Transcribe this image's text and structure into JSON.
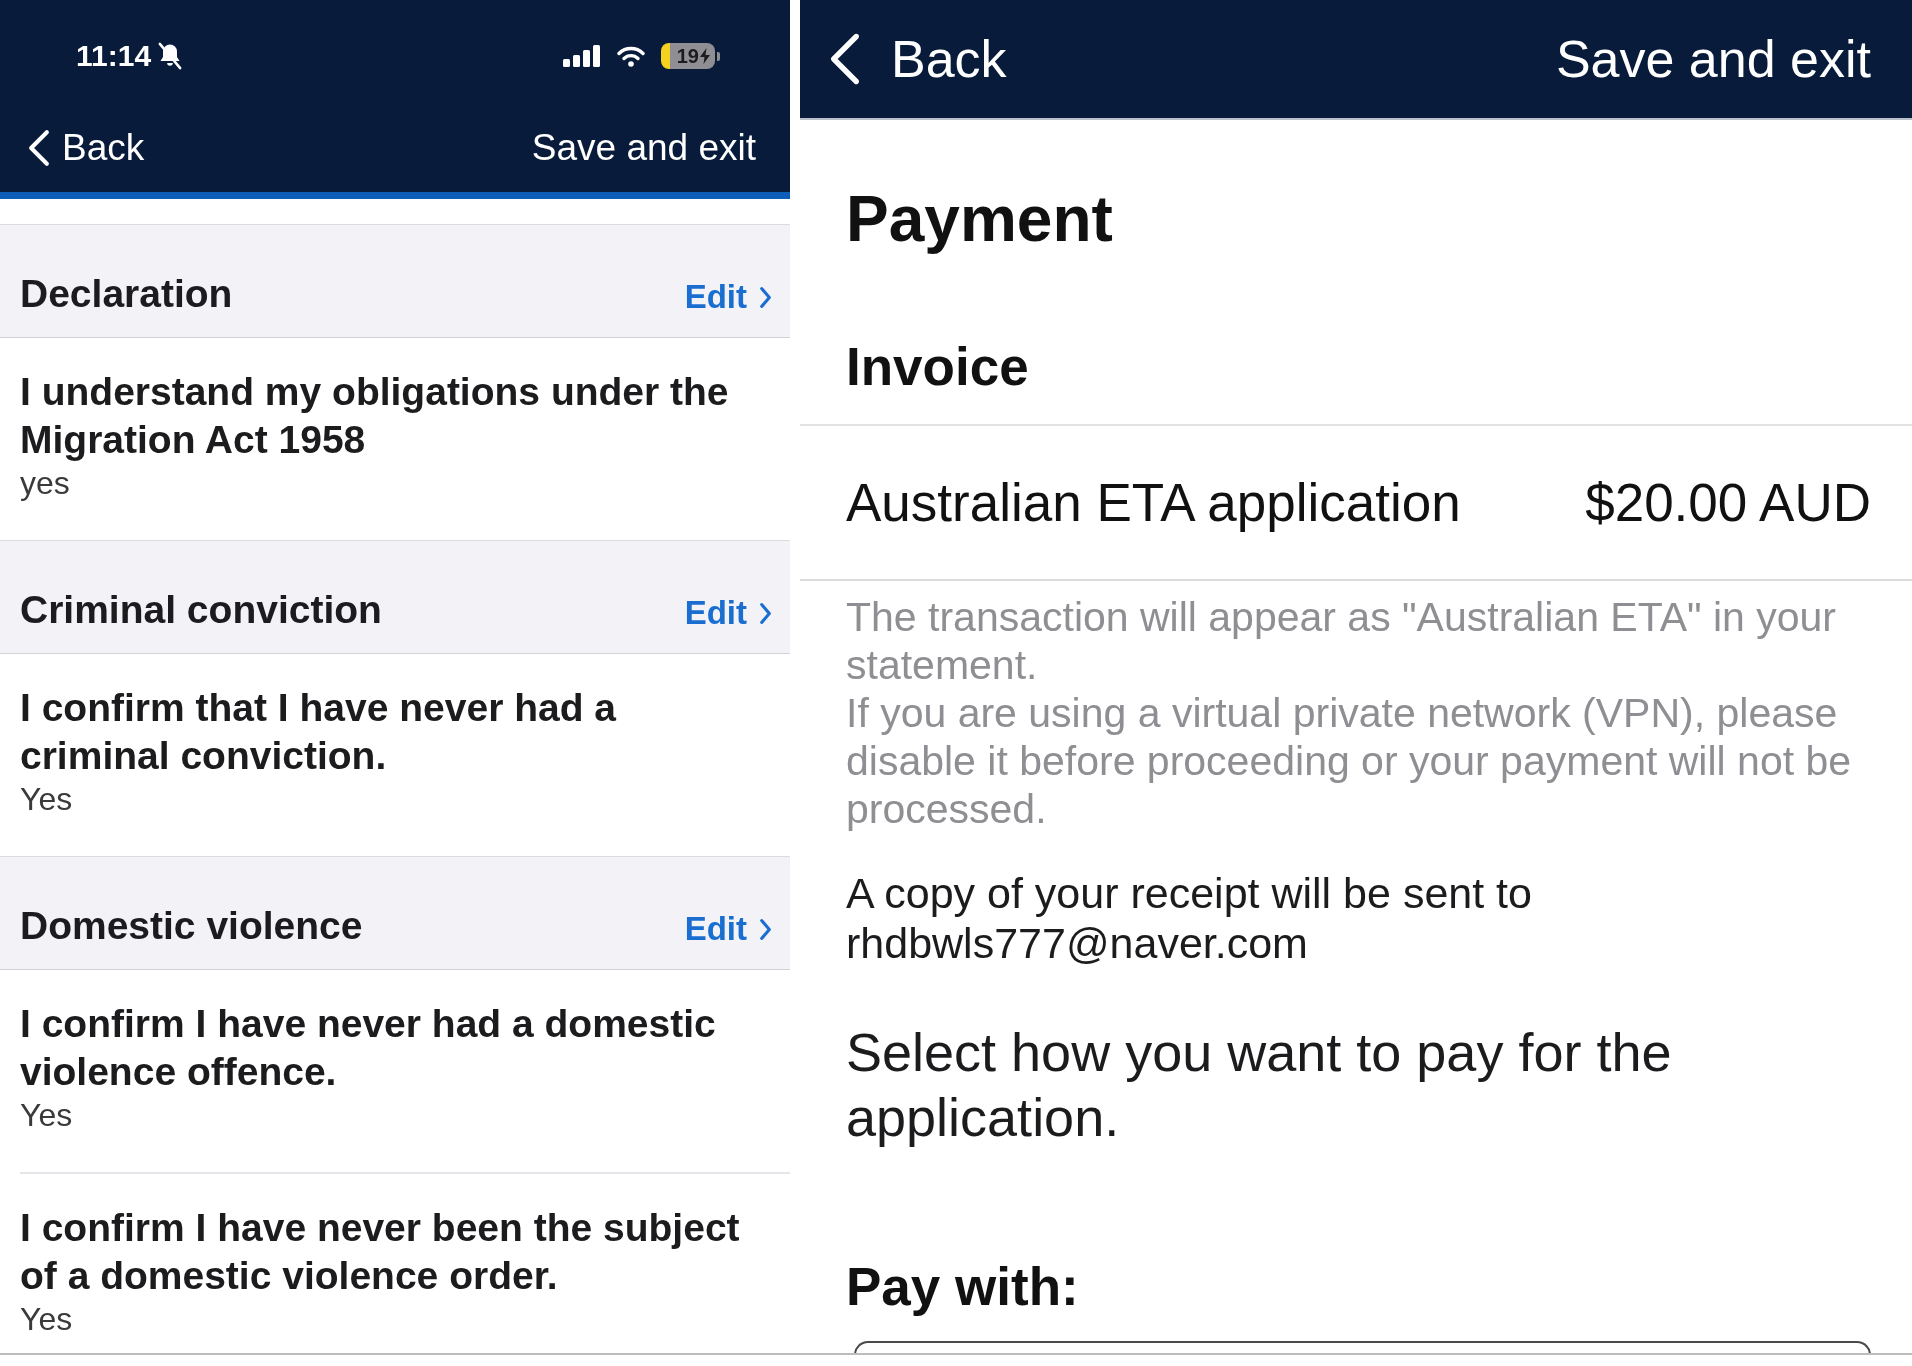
{
  "left_screen": {
    "status_bar": {
      "time": "11:14",
      "battery": "19"
    },
    "nav_bar": {
      "back": "Back",
      "save_exit": "Save and exit"
    },
    "sections": [
      {
        "title": "Declaration",
        "edit": "Edit",
        "items": [
          {
            "question": "I understand my obligations under the Migration Act 1958",
            "answer": "yes"
          }
        ]
      },
      {
        "title": "Criminal conviction",
        "edit": "Edit",
        "items": [
          {
            "question": "I confirm that I have never had a criminal conviction.",
            "answer": "Yes"
          }
        ]
      },
      {
        "title": "Domestic violence",
        "edit": "Edit",
        "items": [
          {
            "question": "I confirm I have never had a domestic violence offence.",
            "answer": "Yes"
          },
          {
            "question": "I confirm I have never been the subject of a domestic violence order.",
            "answer": "Yes"
          }
        ]
      }
    ]
  },
  "right_screen": {
    "nav_bar": {
      "back": "Back",
      "save_exit": "Save and exit"
    },
    "title": "Payment",
    "invoice": {
      "heading": "Invoice",
      "line_items": [
        {
          "description": "Australian ETA application",
          "amount": "$20.00 AUD"
        }
      ]
    },
    "notice": [
      "The transaction will appear as \"Australian ETA\" in your statement.",
      "If you are using a virtual private network (VPN), please disable it before proceeding or your payment will not be processed."
    ],
    "receipt_note": "A copy of your receipt will be sent to rhdbwls777@naver.com",
    "instruction": "Select how you want to pay for the application.",
    "pay_with": "Pay with:"
  }
}
